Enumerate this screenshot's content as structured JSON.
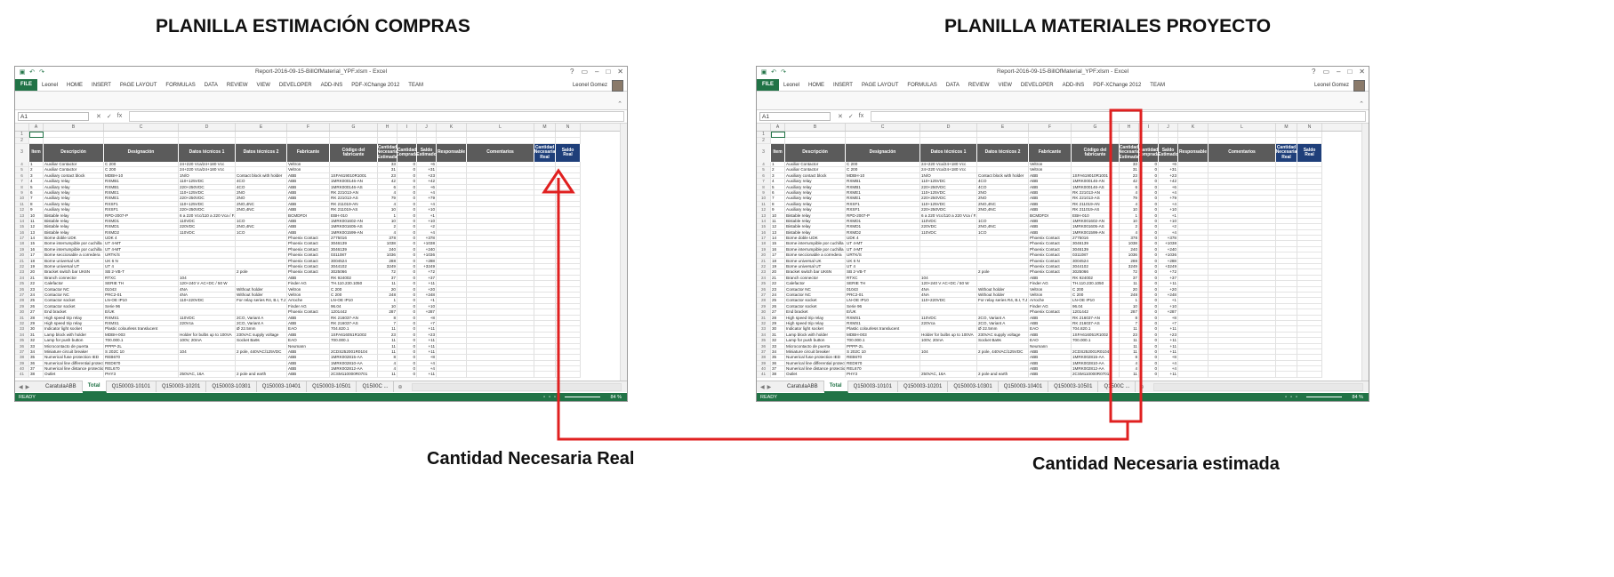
{
  "headings": {
    "left": "PLANILLA ESTIMACIÓN COMPRAS",
    "right": "PLANILLA MATERIALES PROYECTO"
  },
  "captions": {
    "left": "Cantidad Necesaria Real",
    "right": "Cantidad Necesaria estimada"
  },
  "annotation": {
    "color": "#e02020"
  },
  "excel": {
    "window_title": "Report-2016-09-15-BillOfMaterial_YPF.xlsm - Excel",
    "window_controls": [
      "?",
      "▭",
      "–",
      "□",
      "✕"
    ],
    "file_tab": "FILE",
    "tabs": [
      "Leonel",
      "HOME",
      "INSERT",
      "PAGE LAYOUT",
      "FORMULAS",
      "DATA",
      "REVIEW",
      "VIEW",
      "DEVELOPER",
      "ADD-INS",
      "PDF-XChange 2012",
      "TEAM"
    ],
    "user": "Leonel Gomez",
    "name_box": "A1",
    "fx": "fx",
    "col_letters": [
      "A",
      "B",
      "C",
      "D",
      "E",
      "F",
      "G",
      "H",
      "I",
      "J",
      "K",
      "L",
      "M",
      "N"
    ],
    "headers": [
      "Item",
      "Descripción",
      "Designación",
      "Datos técnicos 1",
      "Datos técnicos 2",
      "Fabricante",
      "Código del fabricante",
      "Cantidad Necesaria Estimada",
      "Cantidad Comprada",
      "Saldo Estimado",
      "Responsable",
      "Comentarios",
      "Cantidad Necesaria Real",
      "Saldo Real"
    ],
    "rows": [
      [
        "4",
        "1",
        "Auxiliar Contactor",
        "C 200",
        "24+220 Vca/24+180 Vcc",
        "",
        "Veltron",
        "",
        "33",
        "0",
        "+6"
      ],
      [
        "5",
        "2",
        "Auxiliar Contactor",
        "C 200",
        "24+220 Vca/24+180 Vcc",
        "",
        "Veltron",
        "",
        "31",
        "0",
        "+31"
      ],
      [
        "6",
        "3",
        "Auxiliary contact block",
        "MDBH-10",
        "1N/O",
        "Contact block with holder",
        "ABB",
        "1SFA619010R1001",
        "23",
        "0",
        "+23"
      ],
      [
        "7",
        "4",
        "Auxiliary relay",
        "RXMB1",
        "110+125VDC",
        "4CO",
        "ABB",
        "1MRK000146-AN",
        "42",
        "0",
        "+42"
      ],
      [
        "8",
        "5",
        "Auxiliary relay",
        "RXMB1",
        "220+250VDC",
        "4CO",
        "ABB",
        "1MRK000146-AS",
        "6",
        "0",
        "+6"
      ],
      [
        "9",
        "6",
        "Auxiliary relay",
        "RXME1",
        "110+125VDC",
        "2NO",
        "ABB",
        "RK 221013-AN",
        "4",
        "0",
        "+4"
      ],
      [
        "10",
        "7",
        "Auxiliary relay",
        "RXME1",
        "220+250VDC",
        "2NO",
        "ABB",
        "RK 221013-AS",
        "79",
        "0",
        "+79"
      ],
      [
        "11",
        "8",
        "Auxiliary relay",
        "RXSF1",
        "110+125VDC",
        "2NO,4NC",
        "ABB",
        "RK 211019-AN",
        "4",
        "0",
        "+4"
      ],
      [
        "12",
        "9",
        "Auxiliary relay",
        "RXSF1",
        "220+250VDC",
        "2NO,4NC",
        "ABB",
        "RK 211019-AS",
        "10",
        "0",
        "+10"
      ],
      [
        "13",
        "10",
        "Bistable relay",
        "RPD-2007-P",
        "6 a 220 Vcc/110 a 220 Vca / F.rec.: 1 a 1,5 Hz",
        "",
        "BCMDFDI",
        "EBH-010",
        "1",
        "0",
        "+1"
      ],
      [
        "14",
        "11",
        "Bistable relay",
        "RXMD1",
        "110VDC",
        "1CO",
        "ABB",
        "1MRK001602-AN",
        "10",
        "0",
        "+10"
      ],
      [
        "15",
        "12",
        "Bistable relay",
        "RXMD1",
        "220VDC",
        "2NO,4NC",
        "ABB",
        "1MRK001605-AS",
        "2",
        "0",
        "+2"
      ],
      [
        "16",
        "13",
        "Bistable relay",
        "RXMD2",
        "110VDC",
        "1CO",
        "ABB",
        "1MRK001599-AN",
        "4",
        "0",
        "+4"
      ],
      [
        "17",
        "14",
        "Borne doble UDK",
        "UDK 4",
        "",
        "",
        "Phoenix Contact",
        "2775016",
        "378",
        "0",
        "+378"
      ],
      [
        "18",
        "15",
        "Borne interrumpible por cuchilla",
        "UT 4-MT",
        "",
        "",
        "Phoenix Contact",
        "3046139",
        "1038",
        "0",
        "+1038"
      ],
      [
        "19",
        "16",
        "Borne interrumpible por cuchilla",
        "UT 4-MT",
        "",
        "",
        "Phoenix Contact",
        "3046139",
        "240",
        "0",
        "+240"
      ],
      [
        "20",
        "17",
        "Borne seccionable a corredera",
        "URTK/S",
        "",
        "",
        "Phoenix Contact",
        "0311087",
        "1036",
        "0",
        "+1036"
      ],
      [
        "21",
        "18",
        "Borne universal UK",
        "UK 6 N",
        "",
        "",
        "Phoenix Contact",
        "3004524",
        "288",
        "0",
        "+288"
      ],
      [
        "22",
        "19",
        "Borne universal UT",
        "UT 4",
        "",
        "",
        "Phoenix Contact",
        "3044102",
        "3249",
        "0",
        "+3249"
      ],
      [
        "23",
        "20",
        "Bracket switch bar UK6N",
        "SB 2-VB-T",
        "",
        "2 pole",
        "Phoenix Contact",
        "3025066",
        "72",
        "0",
        "+72"
      ],
      [
        "24",
        "21",
        "Branch connector",
        "RTXC",
        "104",
        "",
        "ABB",
        "RK 924002",
        "37",
        "0",
        "+37"
      ],
      [
        "25",
        "22",
        "Calefactor",
        "SERIE TH",
        "120+240 V AC+DC / 50 W",
        "",
        "Finder AG",
        "TH.110.230.1050",
        "11",
        "0",
        "+11"
      ],
      [
        "26",
        "23",
        "Contactor NC",
        "01043",
        "4NA",
        "Without holder",
        "Veltron",
        "C 200",
        "20",
        "0",
        "+20"
      ],
      [
        "27",
        "24",
        "Contactor NC",
        "PRC2-01",
        "4NA",
        "Without holder",
        "Veltron",
        "C 200",
        "248",
        "0",
        "+248"
      ],
      [
        "28",
        "25",
        "Contactor socket",
        "LN-OE IP10",
        "110+220VDC",
        "For relay series R4, B.I, T.J",
        "Arroche",
        "LN-OE IP10",
        "1",
        "0",
        "+1"
      ],
      [
        "29",
        "26",
        "Contactor socket",
        "Serie 96",
        "",
        "",
        "Finder AG",
        "96.04",
        "10",
        "0",
        "+10"
      ],
      [
        "30",
        "27",
        "End bracket",
        "E/UK",
        "",
        "",
        "Phoenix Contact",
        "1201442",
        "287",
        "0",
        "+287"
      ],
      [
        "31",
        "28",
        "High speed trip relay",
        "RXMS1",
        "110VDC",
        "2CO, Variant A",
        "ABB",
        "RK 216037-AN",
        "8",
        "0",
        "+8"
      ],
      [
        "32",
        "29",
        "High speed trip relay",
        "RXMS1",
        "220Vca",
        "2CO, Variant A",
        "ABB",
        "RK 216037-AS",
        "7",
        "0",
        "+7"
      ],
      [
        "33",
        "30",
        "Indicator light socket",
        "Plastic colourless translucent",
        "",
        "Ø 22.5mm",
        "EAO",
        "704.820.1",
        "11",
        "0",
        "+11"
      ],
      [
        "34",
        "31",
        "Lamp block with holder",
        "MDBH-003",
        "Holder for bulbs up to 100VA",
        "230VAC supply voltage",
        "ABB",
        "1SFA616051R1002",
        "23",
        "0",
        "+23"
      ],
      [
        "35",
        "32",
        "Lamp for push button",
        "700.000.1",
        "100V, 20mA",
        "Socket Ba9s",
        "EAO",
        "700.000.1",
        "11",
        "0",
        "+11"
      ],
      [
        "36",
        "33",
        "Microcontacto de puerta",
        "PPPP-2L",
        "",
        "",
        "Neumann",
        "",
        "11",
        "0",
        "+11"
      ],
      [
        "37",
        "34",
        "Miniature circuit breaker",
        "S 202C 10",
        "104",
        "2 pole, 440VAC/125VDC",
        "ABB",
        "2CDS252001R0104",
        "11",
        "0",
        "+11"
      ],
      [
        "38",
        "35",
        "Numerical fuse protection IED",
        "REB670",
        "",
        "",
        "ABB",
        "1MRK002815-AA",
        "8",
        "0",
        "+8"
      ],
      [
        "39",
        "36",
        "Numerical line differential protection",
        "RED670",
        "",
        "",
        "ABB",
        "1MRK002810-AA",
        "4",
        "0",
        "+4"
      ],
      [
        "40",
        "37",
        "Numerical line distance protection",
        "REL670",
        "",
        "",
        "ABB",
        "1MRK002812-AA",
        "4",
        "0",
        "+4"
      ],
      [
        "41",
        "38",
        "Outlet",
        "PHY3",
        "250VAC, 16A",
        "2 pole and earth",
        "ABB",
        "2CSM110000R0701",
        "11",
        "0",
        "+11"
      ]
    ],
    "sheet_tabs": [
      "CaratulaABB",
      "Total",
      "Q150003-10101",
      "Q150003-10201",
      "Q150003-10301",
      "Q150003-10401",
      "Q150003-10501",
      "Q1500C ..."
    ],
    "active_sheet": "Total",
    "status": "READY",
    "zoom": "84 %"
  }
}
